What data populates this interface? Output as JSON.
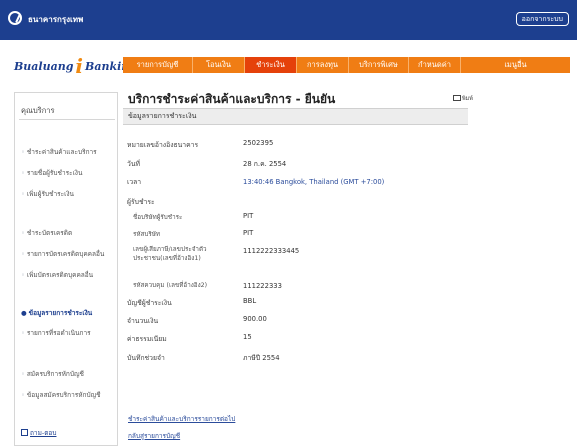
{
  "topbar": {
    "bank_name": "ธนาคารกรุงเทพ",
    "logout": "ออกจากระบบ"
  },
  "brand": {
    "left": "Bualuang",
    "i": "i",
    "right": "Banking"
  },
  "nav": [
    {
      "label": "รายการบัญชี",
      "active": false
    },
    {
      "label": "โอนเงิน",
      "active": false
    },
    {
      "label": "ชำระเงิน",
      "active": true
    },
    {
      "label": "การลงทุน",
      "active": false
    },
    {
      "label": "บริการพิเศษ",
      "active": false
    },
    {
      "label": "กำหนดค่า",
      "active": false
    },
    {
      "label": "เมนูอื่น",
      "active": false
    }
  ],
  "sidebar": {
    "title": "คุณบริการ",
    "items": [
      {
        "label": "ชำระค่าสินค้าและบริการ",
        "active": false
      },
      {
        "label": "รายชื่อผู้รับชำระเงิน",
        "active": false
      },
      {
        "label": "เพิ่มผู้รับชำระเงิน",
        "active": false
      },
      {
        "label": "ชำระบัตรเครดิต",
        "active": false
      },
      {
        "label": "รายการบัตรเครดิตบุคคลอื่น",
        "active": false
      },
      {
        "label": "เพิ่มบัตรเครดิตบุคคลอื่น",
        "active": false
      },
      {
        "label": "ข้อมูลรายการชำระเงิน",
        "active": true
      },
      {
        "label": "รายการที่รอดำเนินการ",
        "active": false
      },
      {
        "label": "สมัครบริการหักบัญชี",
        "active": false
      },
      {
        "label": "ข้อมูลสมัครบริการหักบัญชี",
        "active": false
      }
    ],
    "bottom": "ถาม-ตอบ"
  },
  "main": {
    "title": "บริการชำระค่าสินค้าและบริการ - ยืนยัน",
    "print": "พิมพ์",
    "section": "ข้อมูลรายการชำระเงิน",
    "rows": [
      {
        "label": "หมายเลขอ้างอิงธนาคาร",
        "value": "2502395"
      },
      {
        "label": "วันที่",
        "value": "28 ก.ค. 2554"
      },
      {
        "label": "เวลา",
        "value": "13:40:46 Bangkok, Thailand (GMT +7:00)"
      },
      {
        "label": "ผู้รับชำระ",
        "value": ""
      },
      {
        "label": "ชื่อบริษัทผู้รับชำระ",
        "value": "PIT"
      },
      {
        "label": "รหัสบริษัท",
        "value": "PIT"
      },
      {
        "label": "เลขผู้เสียภาษี/เลขประจำตัว\nประชาชน(เลขที่อ้างอิง1)",
        "value": "1112222333445"
      },
      {
        "label": "รหัสควบคุม (เลขที่อ้างอิง2)",
        "value": "111222333"
      },
      {
        "label": "บัญชีผู้ชำระเงิน",
        "value": "BBL"
      },
      {
        "label": "จำนวนเงิน",
        "value": "900.00"
      },
      {
        "label": "ค่าธรรมเนียม",
        "value": "15"
      },
      {
        "label": "บันทึกช่วยจำ",
        "value": "ภาษีปี 2554"
      }
    ],
    "links": [
      "ชำระค่าสินค้าและบริการรายการต่อไป",
      "กลับสู่รายการบัญชี"
    ]
  }
}
